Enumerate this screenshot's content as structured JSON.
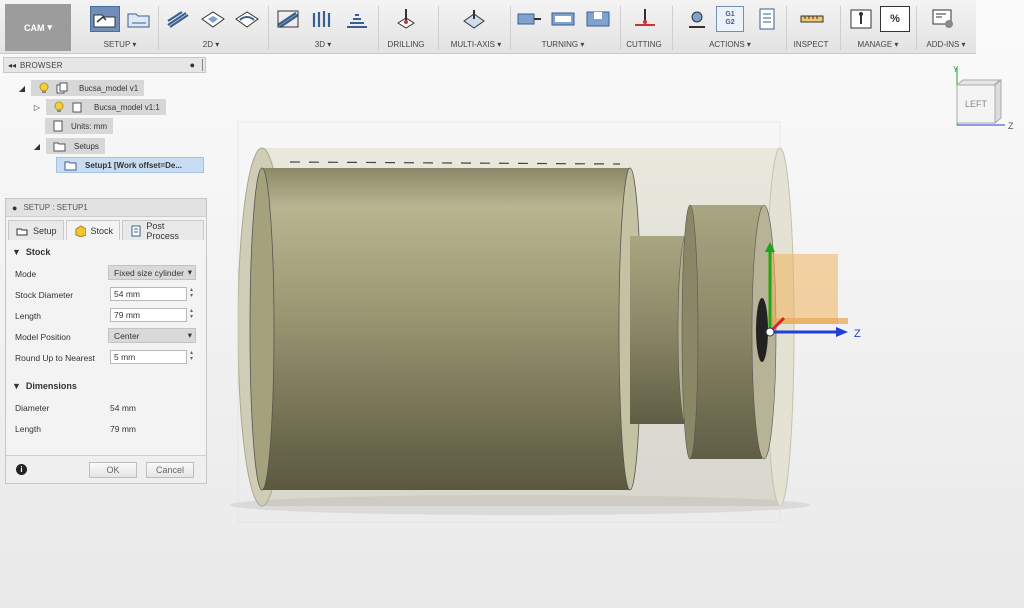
{
  "toolbar": {
    "workspace": "CAM",
    "groups": {
      "setup": "SETUP",
      "d2": "2D",
      "d3": "3D",
      "drilling": "DRILLING",
      "multiaxis": "MULTI-AXIS",
      "turning": "TURNING",
      "cutting": "CUTTING",
      "actions": "ACTIONS",
      "inspect": "INSPECT",
      "manage": "MANAGE",
      "addins": "ADD-INS"
    },
    "g_code_lines": [
      "G1",
      "G2"
    ],
    "percent_symbol": "%"
  },
  "browser": {
    "title": "BROWSER",
    "tree": [
      {
        "label": "Bucsa_model v1"
      },
      {
        "label": "Bucsa_model v1:1"
      },
      {
        "label": "Units: mm"
      },
      {
        "label": "Setups"
      },
      {
        "label": "Setup1 [Work offset=De..."
      }
    ]
  },
  "panel": {
    "title": "SETUP : SETUP1",
    "tabs": [
      "Setup",
      "Stock",
      "Post Process"
    ],
    "stock": {
      "section": "Stock",
      "mode_label": "Mode",
      "mode_value": "Fixed size cylinder",
      "diameter_label": "Stock Diameter",
      "diameter_value": "54 mm",
      "length_label": "Length",
      "length_value": "79 mm",
      "position_label": "Model Position",
      "position_value": "Center",
      "round_label": "Round Up to Nearest",
      "round_value": "5 mm"
    },
    "dimensions": {
      "section": "Dimensions",
      "diameter_label": "Diameter",
      "diameter_value": "54 mm",
      "length_label": "Length",
      "length_value": "79 mm"
    },
    "ok": "OK",
    "cancel": "Cancel"
  },
  "viewport": {
    "axis_label": "Z",
    "viewcube_face": "LEFT",
    "viewcube_axes": {
      "y": "Y",
      "z": "Z"
    }
  }
}
